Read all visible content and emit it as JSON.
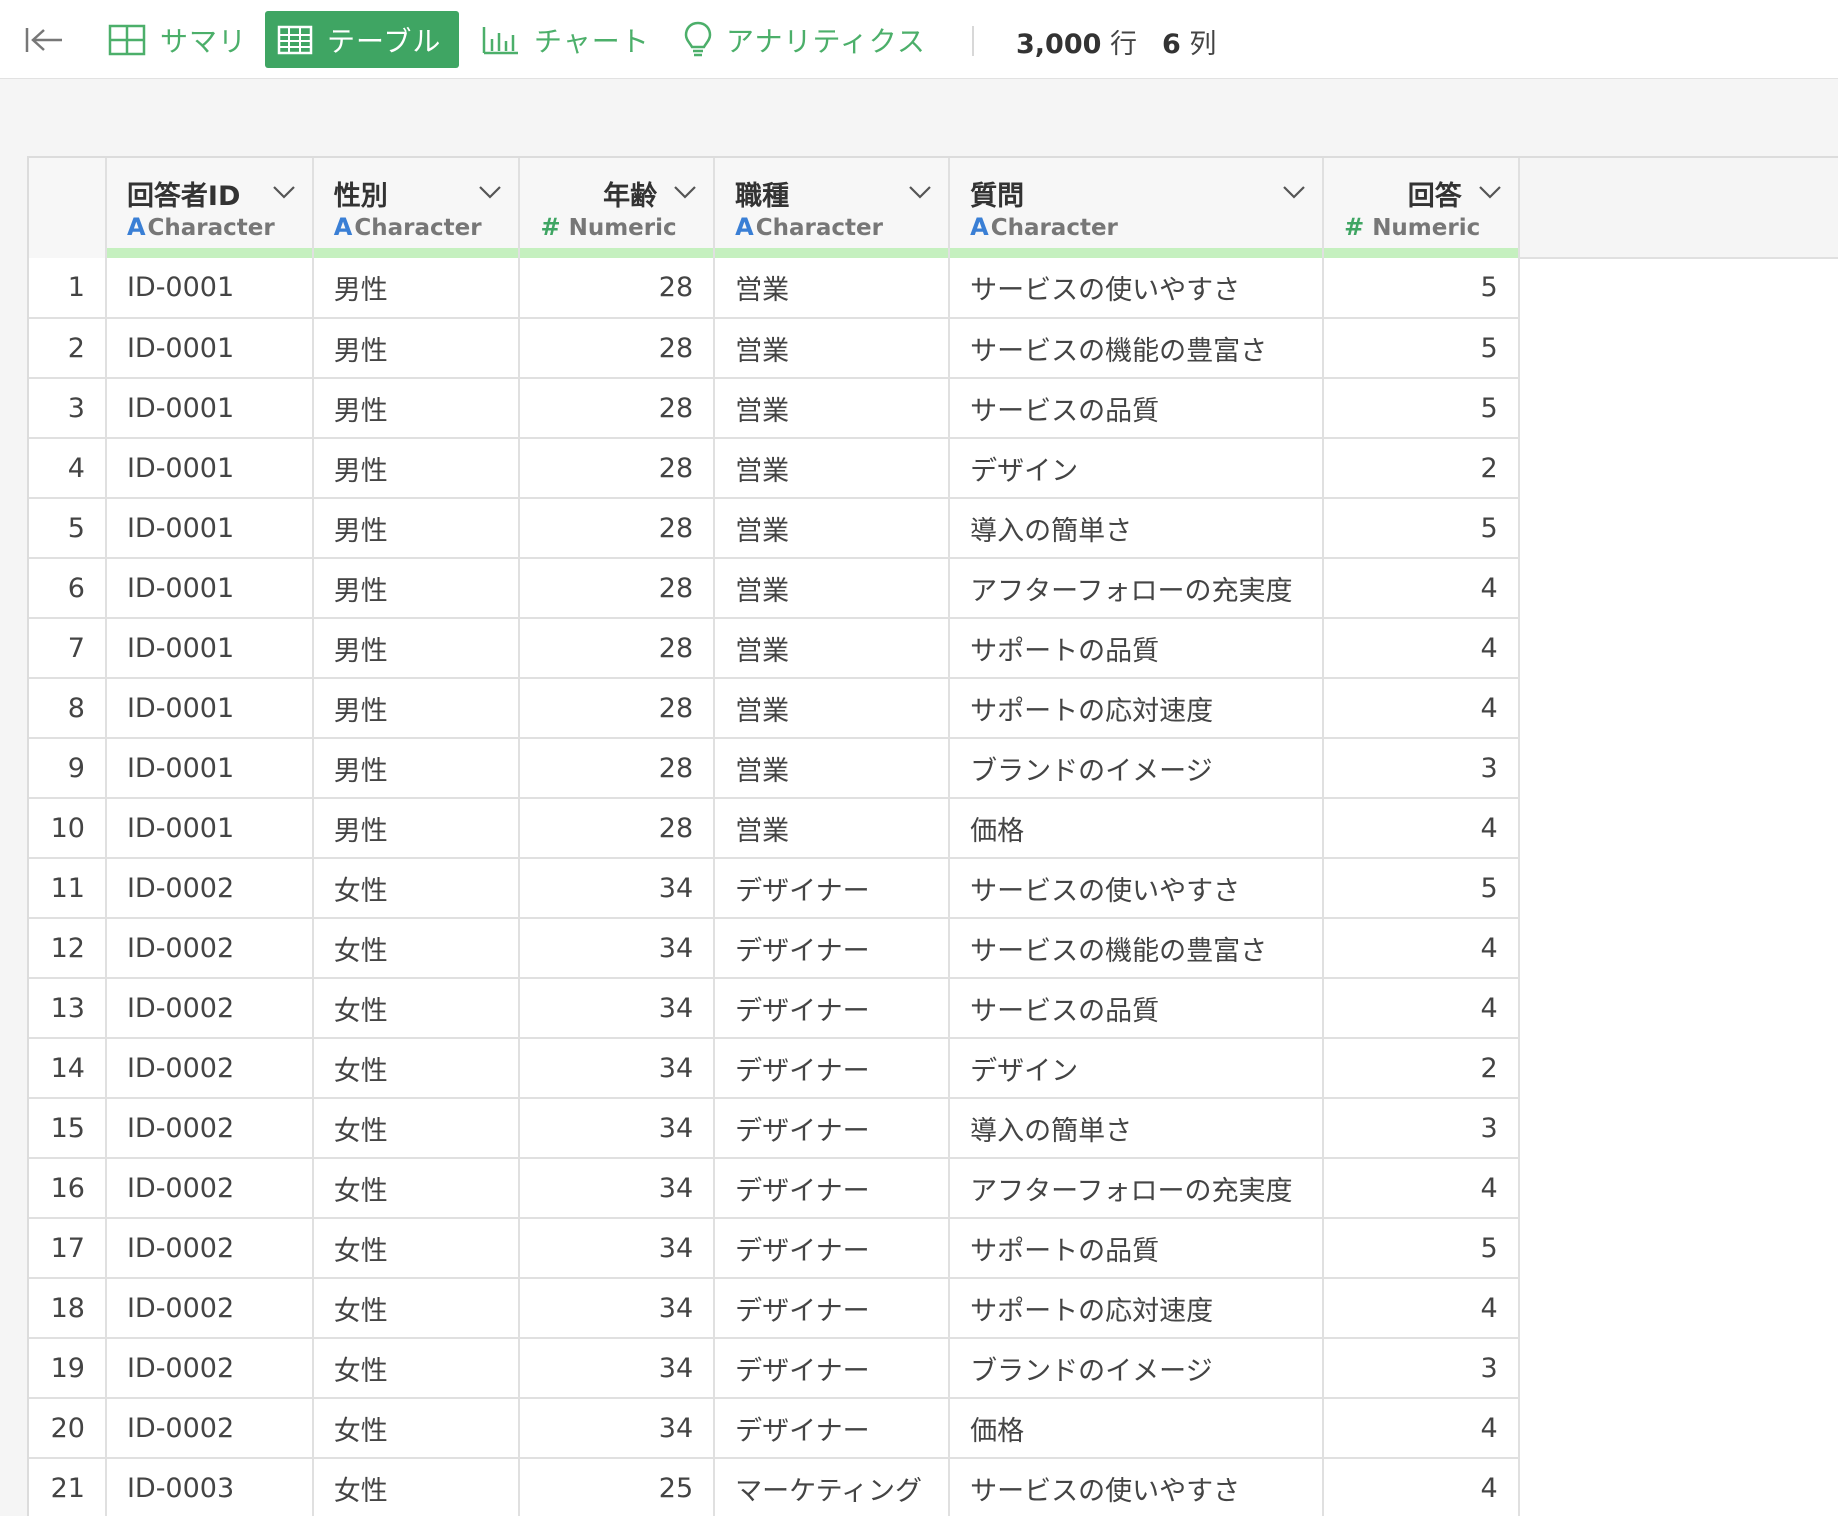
{
  "toolbar": {
    "tabs": [
      {
        "label": "サマリ",
        "icon": "summary-grid-icon"
      },
      {
        "label": "テーブル",
        "icon": "table-icon",
        "active": true
      },
      {
        "label": "チャート",
        "icon": "bar-chart-icon"
      },
      {
        "label": "アナリティクス",
        "icon": "lightbulb-icon"
      }
    ],
    "rows_count": "3,000",
    "rows_unit": "行",
    "cols_count": "6",
    "cols_unit": "列",
    "accent_color": "#3fa563"
  },
  "table": {
    "columns": [
      {
        "name": "回答者ID",
        "type": "Character",
        "type_mark": "A"
      },
      {
        "name": "性別",
        "type": "Character",
        "type_mark": "A"
      },
      {
        "name": "年齢",
        "type": "Numeric",
        "type_mark": "#"
      },
      {
        "name": "職種",
        "type": "Character",
        "type_mark": "A"
      },
      {
        "name": "質問",
        "type": "Character",
        "type_mark": "A"
      },
      {
        "name": "回答",
        "type": "Numeric",
        "type_mark": "#"
      }
    ],
    "rows": [
      [
        "1",
        "ID-0001",
        "男性",
        "28",
        "営業",
        "サービスの使いやすさ",
        "5"
      ],
      [
        "2",
        "ID-0001",
        "男性",
        "28",
        "営業",
        "サービスの機能の豊富さ",
        "5"
      ],
      [
        "3",
        "ID-0001",
        "男性",
        "28",
        "営業",
        "サービスの品質",
        "5"
      ],
      [
        "4",
        "ID-0001",
        "男性",
        "28",
        "営業",
        "デザイン",
        "2"
      ],
      [
        "5",
        "ID-0001",
        "男性",
        "28",
        "営業",
        "導入の簡単さ",
        "5"
      ],
      [
        "6",
        "ID-0001",
        "男性",
        "28",
        "営業",
        "アフターフォローの充実度",
        "4"
      ],
      [
        "7",
        "ID-0001",
        "男性",
        "28",
        "営業",
        "サポートの品質",
        "4"
      ],
      [
        "8",
        "ID-0001",
        "男性",
        "28",
        "営業",
        "サポートの応対速度",
        "4"
      ],
      [
        "9",
        "ID-0001",
        "男性",
        "28",
        "営業",
        "ブランドのイメージ",
        "3"
      ],
      [
        "10",
        "ID-0001",
        "男性",
        "28",
        "営業",
        "価格",
        "4"
      ],
      [
        "11",
        "ID-0002",
        "女性",
        "34",
        "デザイナー",
        "サービスの使いやすさ",
        "5"
      ],
      [
        "12",
        "ID-0002",
        "女性",
        "34",
        "デザイナー",
        "サービスの機能の豊富さ",
        "4"
      ],
      [
        "13",
        "ID-0002",
        "女性",
        "34",
        "デザイナー",
        "サービスの品質",
        "4"
      ],
      [
        "14",
        "ID-0002",
        "女性",
        "34",
        "デザイナー",
        "デザイン",
        "2"
      ],
      [
        "15",
        "ID-0002",
        "女性",
        "34",
        "デザイナー",
        "導入の簡単さ",
        "3"
      ],
      [
        "16",
        "ID-0002",
        "女性",
        "34",
        "デザイナー",
        "アフターフォローの充実度",
        "4"
      ],
      [
        "17",
        "ID-0002",
        "女性",
        "34",
        "デザイナー",
        "サポートの品質",
        "5"
      ],
      [
        "18",
        "ID-0002",
        "女性",
        "34",
        "デザイナー",
        "サポートの応対速度",
        "4"
      ],
      [
        "19",
        "ID-0002",
        "女性",
        "34",
        "デザイナー",
        "ブランドのイメージ",
        "3"
      ],
      [
        "20",
        "ID-0002",
        "女性",
        "34",
        "デザイナー",
        "価格",
        "4"
      ],
      [
        "21",
        "ID-0003",
        "女性",
        "25",
        "マーケティング",
        "サービスの使いやすさ",
        "4"
      ]
    ]
  }
}
